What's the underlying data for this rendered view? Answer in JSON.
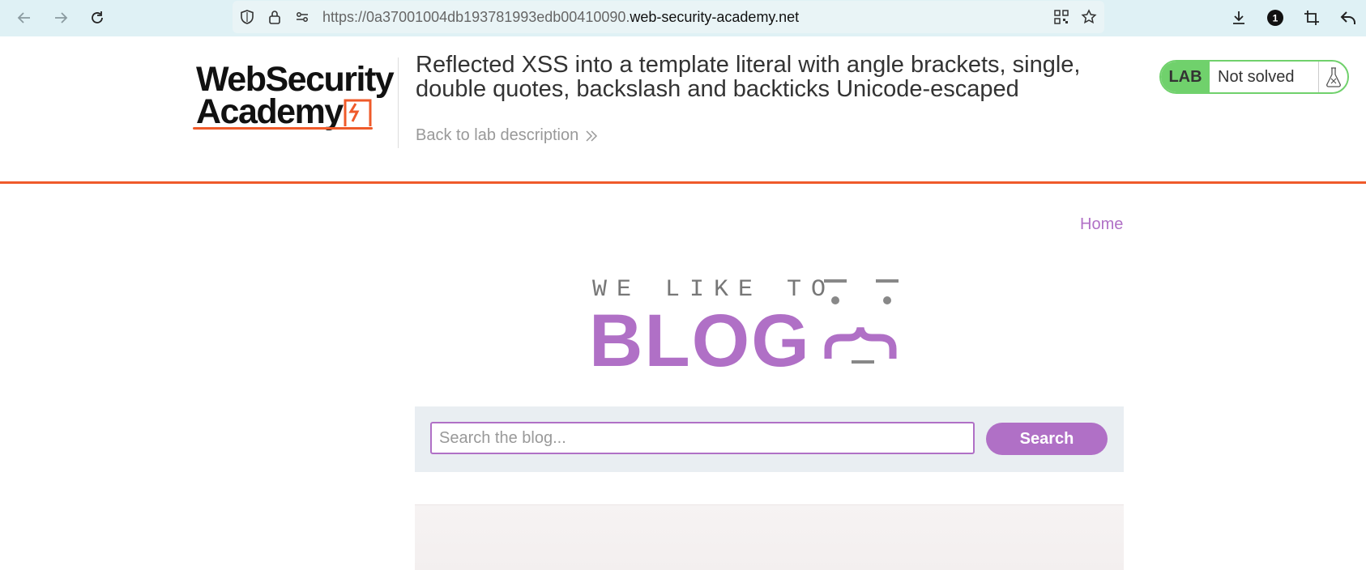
{
  "browser": {
    "url_prefix": "https://0a37001004db193781993edb00410090.",
    "url_domain": "web-security-academy.net",
    "extensions_badge": "1",
    "nav_icons": [
      "back-icon",
      "forward-icon",
      "reload-icon"
    ],
    "url_icons": [
      "shield-icon",
      "lock-icon",
      "permissions-icon"
    ],
    "right_icons": [
      "qr-code-icon",
      "bookmark-star-icon",
      "download-icon",
      "extensions-icon",
      "crop-icon",
      "undo-icon"
    ]
  },
  "lab": {
    "logo_line1": "WebSecurity",
    "logo_line2": "Academy",
    "title": "Reflected XSS into a template literal with angle brackets, single, double quotes, backslash and backticks Unicode-escaped",
    "back_link": "Back to lab description",
    "status_badge": "LAB",
    "status_text": "Not solved",
    "accent_color": "#ef5a2a",
    "status_color": "#70d16c"
  },
  "blog": {
    "nav_home": "Home",
    "banner_top": "WE LIKE TO",
    "banner_word": "BLOG",
    "search_placeholder": "Search the blog...",
    "search_value": "",
    "search_button": "Search",
    "brand_color": "#b070c6"
  }
}
